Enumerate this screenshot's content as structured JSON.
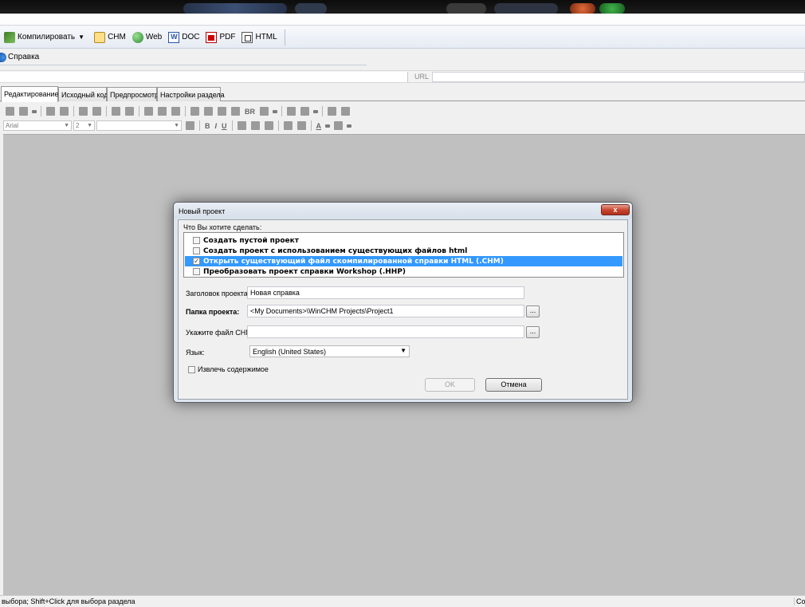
{
  "main_toolbar": {
    "compile_label": "Компилировать",
    "chm_label": "CHM",
    "web_label": "Web",
    "doc_label": "DOC",
    "pdf_label": "PDF",
    "html_label": "HTML"
  },
  "menu": {
    "help_label": "Справка"
  },
  "address_bar": {
    "url_label": "URL",
    "url_value": ""
  },
  "tabs": [
    {
      "label": "Редактирование",
      "active": true
    },
    {
      "label": "Исходный код",
      "active": false
    },
    {
      "label": "Предпросмотр",
      "active": false
    },
    {
      "label": "Настройки раздела",
      "active": false
    }
  ],
  "format_toolbar": {
    "font_name": "Arial",
    "font_size": "2",
    "style_value": "",
    "br_label": "BR",
    "bold_label": "B",
    "italic_label": "I",
    "underline_label": "U",
    "font_color_label": "A"
  },
  "statusbar": {
    "hint": "выбора; Shift+Click для выбора раздела",
    "right_text": "Co"
  },
  "dialog": {
    "title": "Новый проект",
    "close_label": "x",
    "question": "Что Вы хотите сделать:",
    "options": [
      {
        "label": "Создать пустой проект",
        "checked": false,
        "selected": false
      },
      {
        "label": "Создать проект с использованием существующих файлов html",
        "checked": false,
        "selected": false
      },
      {
        "label": "Открыть существующий файл скомпилированной справки HTML (.CHM)",
        "checked": true,
        "selected": true
      },
      {
        "label": "Преобразовать проект справки Workshop (.HHP)",
        "checked": false,
        "selected": false
      }
    ],
    "checkmark": "✓",
    "title_label": "Заголовок проекта:",
    "title_value": "Новая справка",
    "folder_label": "Папка проекта:",
    "folder_value": "<My Documents>\\WinCHM Projects\\Project1",
    "chm_label": "Укажите файл CHM:",
    "chm_value": "",
    "browse_label": "...",
    "language_label": "Язык:",
    "language_value": "English (United States)",
    "extract_label": "Извлечь содержимое",
    "extract_checked": false,
    "ok_label": "OK",
    "cancel_label": "Отмена"
  }
}
